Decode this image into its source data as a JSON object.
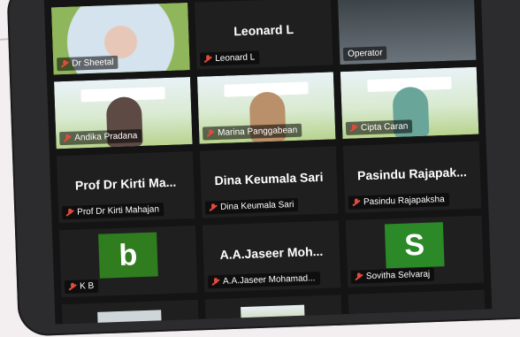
{
  "participants": [
    {
      "name": "Dr Sheetal",
      "big": "",
      "kind": "video",
      "active": true
    },
    {
      "name": "Leonard L",
      "big": "Leonard L",
      "kind": "name"
    },
    {
      "name": "Operator",
      "big": "",
      "kind": "video-dark"
    },
    {
      "name": "Andika Pradana",
      "big": "",
      "kind": "video"
    },
    {
      "name": "Marina Panggabean",
      "big": "",
      "kind": "video"
    },
    {
      "name": "Cipta Caran",
      "big": "",
      "kind": "video"
    },
    {
      "name": "Prof Dr Kirti Mahajan",
      "big": "Prof Dr Kirti Ma...",
      "kind": "name"
    },
    {
      "name": "Dina Keumala Sari",
      "big": "Dina Keumala Sari",
      "kind": "name"
    },
    {
      "name": "Pasindu Rajapaksha",
      "big": "Pasindu  Rajapak...",
      "kind": "name"
    },
    {
      "name": "K B",
      "big": "",
      "kind": "avatar",
      "letter": "b",
      "color": "#2f7d1f"
    },
    {
      "name": "A.A.Jaseer Mohamad...",
      "big": "A.A.Jaseer  Moh...",
      "kind": "name"
    },
    {
      "name": "Sovitha Selvaraj",
      "big": "",
      "kind": "avatar",
      "letter": "S",
      "color": "#2b8a27"
    },
    {
      "name": "",
      "big": "",
      "kind": "partial"
    },
    {
      "name": "",
      "big": "",
      "kind": "partial-video"
    },
    {
      "name": "",
      "big": "",
      "kind": "partial"
    }
  ]
}
